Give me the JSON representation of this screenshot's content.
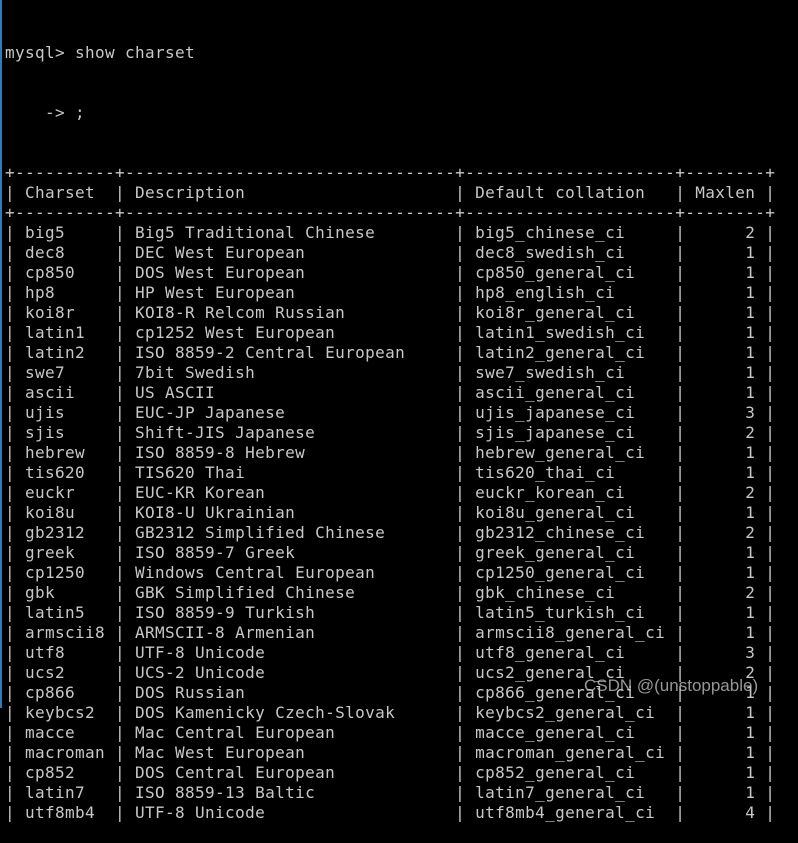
{
  "terminal": {
    "prompt_line": "mysql> show charset",
    "continuation_line": "    -> ;",
    "columns": [
      "Charset",
      "Description",
      "Default collation",
      "Maxlen"
    ],
    "rows": [
      [
        "big5",
        "Big5 Traditional Chinese",
        "big5_chinese_ci",
        "2"
      ],
      [
        "dec8",
        "DEC West European",
        "dec8_swedish_ci",
        "1"
      ],
      [
        "cp850",
        "DOS West European",
        "cp850_general_ci",
        "1"
      ],
      [
        "hp8",
        "HP West European",
        "hp8_english_ci",
        "1"
      ],
      [
        "koi8r",
        "KOI8-R Relcom Russian",
        "koi8r_general_ci",
        "1"
      ],
      [
        "latin1",
        "cp1252 West European",
        "latin1_swedish_ci",
        "1"
      ],
      [
        "latin2",
        "ISO 8859-2 Central European",
        "latin2_general_ci",
        "1"
      ],
      [
        "swe7",
        "7bit Swedish",
        "swe7_swedish_ci",
        "1"
      ],
      [
        "ascii",
        "US ASCII",
        "ascii_general_ci",
        "1"
      ],
      [
        "ujis",
        "EUC-JP Japanese",
        "ujis_japanese_ci",
        "3"
      ],
      [
        "sjis",
        "Shift-JIS Japanese",
        "sjis_japanese_ci",
        "2"
      ],
      [
        "hebrew",
        "ISO 8859-8 Hebrew",
        "hebrew_general_ci",
        "1"
      ],
      [
        "tis620",
        "TIS620 Thai",
        "tis620_thai_ci",
        "1"
      ],
      [
        "euckr",
        "EUC-KR Korean",
        "euckr_korean_ci",
        "2"
      ],
      [
        "koi8u",
        "KOI8-U Ukrainian",
        "koi8u_general_ci",
        "1"
      ],
      [
        "gb2312",
        "GB2312 Simplified Chinese",
        "gb2312_chinese_ci",
        "2"
      ],
      [
        "greek",
        "ISO 8859-7 Greek",
        "greek_general_ci",
        "1"
      ],
      [
        "cp1250",
        "Windows Central European",
        "cp1250_general_ci",
        "1"
      ],
      [
        "gbk",
        "GBK Simplified Chinese",
        "gbk_chinese_ci",
        "2"
      ],
      [
        "latin5",
        "ISO 8859-9 Turkish",
        "latin5_turkish_ci",
        "1"
      ],
      [
        "armscii8",
        "ARMSCII-8 Armenian",
        "armscii8_general_ci",
        "1"
      ],
      [
        "utf8",
        "UTF-8 Unicode",
        "utf8_general_ci",
        "3"
      ],
      [
        "ucs2",
        "UCS-2 Unicode",
        "ucs2_general_ci",
        "2"
      ],
      [
        "cp866",
        "DOS Russian",
        "cp866_general_ci",
        "1"
      ],
      [
        "keybcs2",
        "DOS Kamenicky Czech-Slovak",
        "keybcs2_general_ci",
        "1"
      ],
      [
        "macce",
        "Mac Central European",
        "macce_general_ci",
        "1"
      ],
      [
        "macroman",
        "Mac West European",
        "macroman_general_ci",
        "1"
      ],
      [
        "cp852",
        "DOS Central European",
        "cp852_general_ci",
        "1"
      ],
      [
        "latin7",
        "ISO 8859-13 Baltic",
        "latin7_general_ci",
        "1"
      ],
      [
        "utf8mb4",
        "UTF-8 Unicode",
        "utf8mb4_general_ci",
        "4"
      ]
    ]
  },
  "watermark": "CSDN @(unstoppable)",
  "colors": {
    "background": "#000000",
    "text": "#c8c8c8",
    "window_edge": "#3a78b0"
  }
}
